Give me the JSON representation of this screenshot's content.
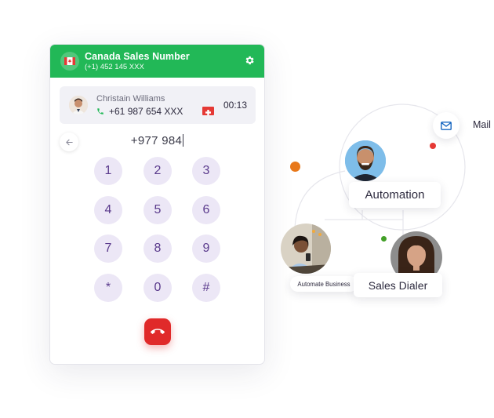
{
  "dialer": {
    "header": {
      "title": "Canada Sales Number",
      "subtitle": "(+1) 452 145 XXX",
      "flag_icon": "canada-flag-icon",
      "settings_icon": "gear-icon"
    },
    "active_call": {
      "name": "Christain Williams",
      "number": "+61 987 654 XXX",
      "timer": "00:13",
      "country_flag_icon": "switzerland-flag-icon"
    },
    "dialed_number": "+977 984",
    "keys": [
      "1",
      "2",
      "3",
      "4",
      "5",
      "6",
      "7",
      "8",
      "9",
      "*",
      "0",
      "#"
    ],
    "hangup_icon": "phone-hangup-icon",
    "colors": {
      "header": "#22b857",
      "key_bg": "#ece7f6",
      "key_text": "#5a3a8c",
      "hangup": "#e02a2a"
    }
  },
  "network": {
    "mail_label": "Mail",
    "automation_label": "Automation",
    "automate_business_label": "Automate Business",
    "sales_dialer_label": "Sales Dialer",
    "colors": {
      "orange_dot": "#e8781a",
      "red_dot": "#e53935",
      "green_dot": "#43a028",
      "mail_icon": "#1565c0"
    }
  }
}
